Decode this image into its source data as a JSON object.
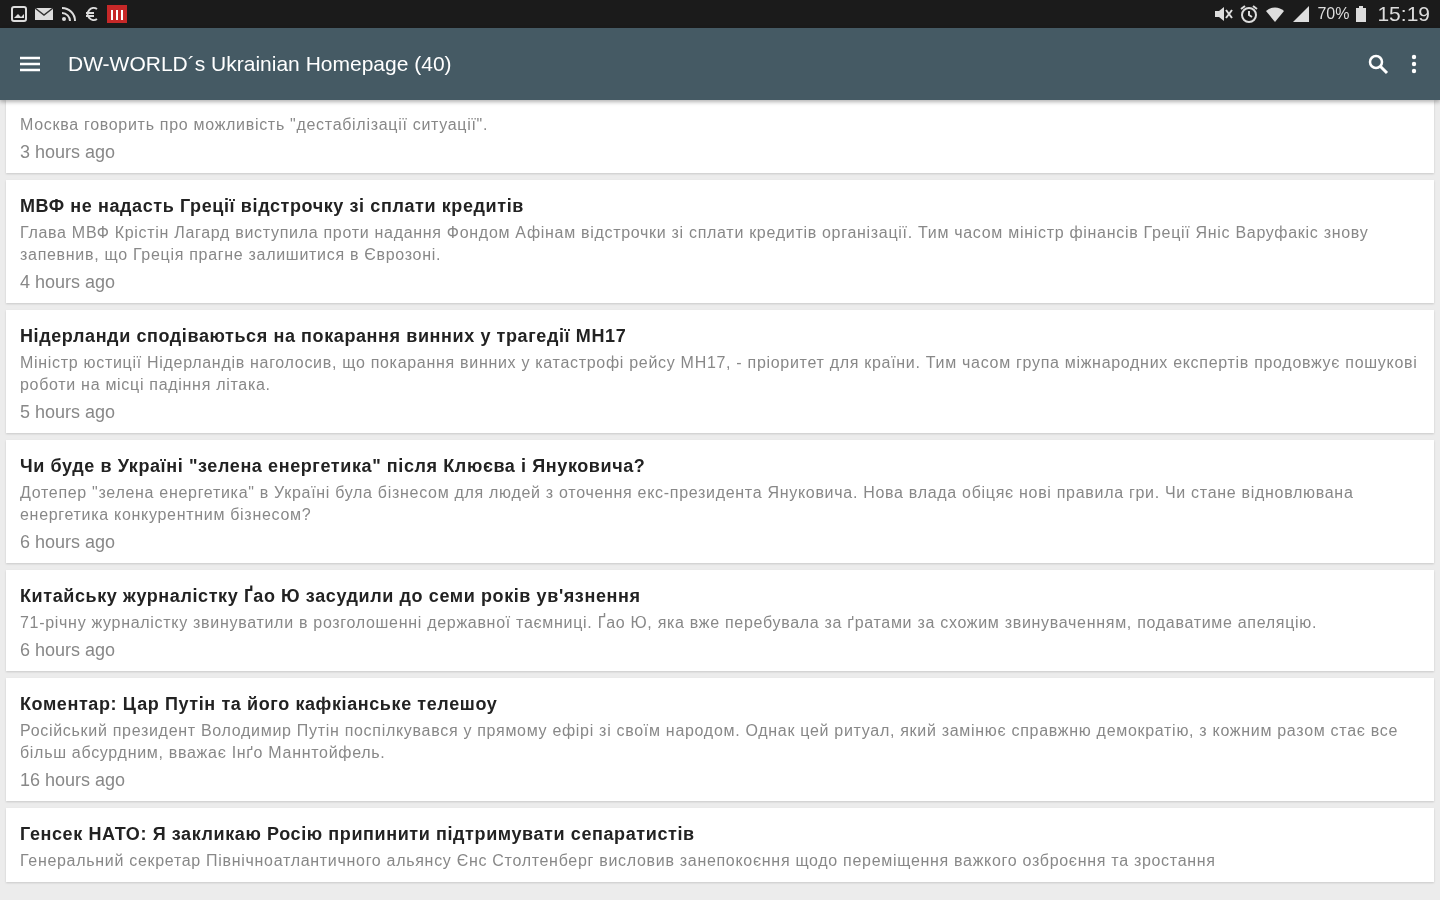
{
  "status_bar": {
    "battery": "70%",
    "time": "15:19"
  },
  "app_bar": {
    "title": "DW-WORLD´s Ukrainian Homepage (40)"
  },
  "articles": [
    {
      "description": "Москва говорить про можливість \"дестабілізації ситуації\".",
      "time": "3 hours ago"
    },
    {
      "title": "МВФ не надасть Греції відстрочку зі сплати кредитів",
      "description": "Глава МВФ Крістін Лагард виступила проти надання Фондом Афінам відстрочки зі сплати кредитів організації. Тим часом міністр фінансів Греції Яніс Варуфакіс знову запевнив, що Греція прагне залишитися в Єврозоні.",
      "time": "4 hours ago"
    },
    {
      "title": "Нідерланди сподіваються на покарання винних у трагедії MH17",
      "description": "Міністр юстиції Нідерландів наголосив, що покарання винних у катастрофі рейсу MH17, - пріоритет для країни. Тим часом група міжнародних експертів продовжує пошукові роботи на місці падіння літака.",
      "time": "5 hours ago"
    },
    {
      "title": "Чи буде в Україні \"зелена енергетика\" після Клюєва і Януковича?",
      "description": "Дотепер \"зелена енергетика\" в Україні була бізнесом для людей з оточення екс-президента Януковича. Нова влада обіцяє нові правила гри. Чи стане відновлювана енергетика конкурентним бізнесом?",
      "time": "6 hours ago"
    },
    {
      "title": "Китайську журналістку Ґао Ю засудили до семи років ув'язнення",
      "description": "71-річну журналістку звинуватили в розголошенні державної таємниці. Ґао Ю, яка вже перебувала за ґратами за схожим звинуваченням, подаватиме апеляцію.",
      "time": "6 hours ago"
    },
    {
      "title": "Коментар: Цар Путін та його кафкіанське телешоу",
      "description": "Російський президент Володимир Путін поспілкувався у прямому ефірі зі своїм народом. Однак цей ритуал, який замінює справжню демократію, з кожним разом стає все більш абсурдним, вважає Інґо Маннтойфель.",
      "time": "16 hours ago"
    },
    {
      "title": "Генсек НАТО: Я закликаю Росію припинити підтримувати сепаратистів",
      "description": "Генеральний секретар Північноатлантичного альянсу Єнс Столтенберг висловив занепокоєння щодо переміщення важкого озброєння та зростання"
    }
  ]
}
